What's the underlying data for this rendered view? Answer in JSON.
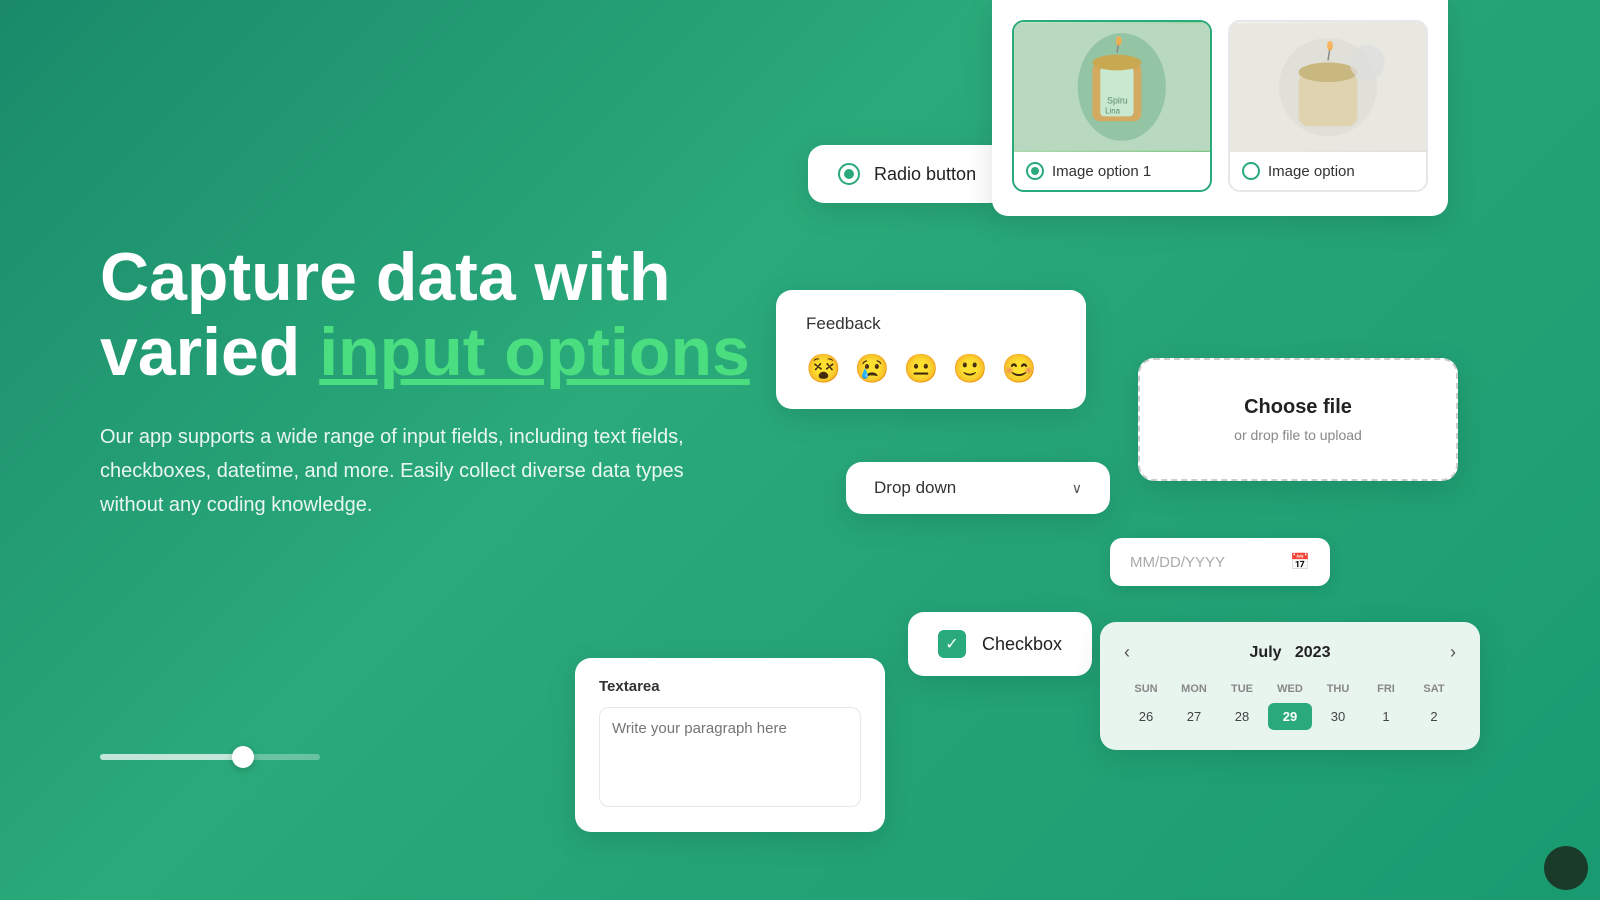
{
  "hero": {
    "title_part1": "Capture data with",
    "title_part2": "varied ",
    "title_highlight": "input options",
    "description": "Our app supports a wide range of input fields, including text fields, checkboxes, datetime, and more. Easily collect diverse data types without any coding knowledge."
  },
  "radio_button": {
    "label": "Radio button"
  },
  "image_options": {
    "option1_label": "Image option 1",
    "option2_label": "Image option"
  },
  "feedback": {
    "title": "Feedback",
    "emojis": [
      "😵",
      "😢",
      "😐",
      "🙂",
      "😊"
    ]
  },
  "dropdown": {
    "placeholder": "Drop down",
    "chevron": "∨"
  },
  "file_upload": {
    "title": "Choose file",
    "subtitle": "or drop file to upload"
  },
  "date_input": {
    "placeholder": "MM/DD/YYYY"
  },
  "checkbox": {
    "label": "Checkbox",
    "checkmark": "✓"
  },
  "calendar": {
    "month": "July",
    "year": "2023",
    "day_headers": [
      "SUN",
      "MON",
      "TUE",
      "WED",
      "THU",
      "FRI",
      "SAT"
    ],
    "days": [
      "26",
      "27",
      "28",
      "29",
      "30",
      "1",
      "2"
    ]
  },
  "textarea": {
    "label": "Textarea",
    "placeholder": "Write your paragraph here"
  },
  "colors": {
    "primary_green": "#2aaa7a",
    "light_green": "#4ade80",
    "bg_green": "#1e9a72"
  }
}
